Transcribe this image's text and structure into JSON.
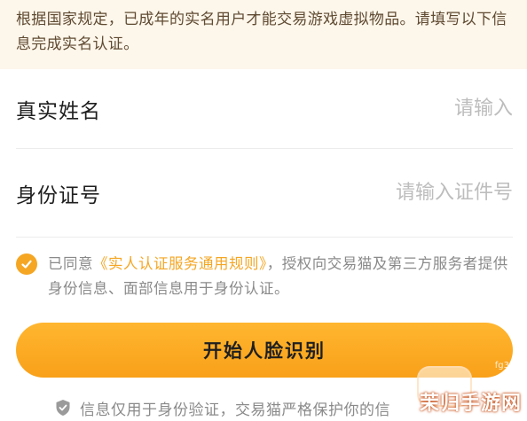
{
  "notice": {
    "text": "根据国家规定，已成年的实名用户才能交易游戏虚拟物品。请填写以下信息完成实名认证。"
  },
  "form": {
    "name_label": "真实姓名",
    "name_placeholder": "请输入",
    "id_label": "身份证号",
    "id_placeholder": "请输入证件号"
  },
  "agreement": {
    "checked": true,
    "prefix": "已同意",
    "link": "《实人认证服务通用规则》",
    "suffix": "，授权向交易猫及第三方服务者提供身份信息、面部信息用于身份认证。"
  },
  "cta": {
    "label": "开始人脸识别"
  },
  "footer": {
    "privacy_text": "信息仅用于身份验证，交易猫严格保护你的信"
  },
  "watermark": {
    "text": "茉归手游网",
    "url": "fg3"
  },
  "colors": {
    "accent": "#f5a623",
    "notice_bg": "#fdf6ea"
  }
}
